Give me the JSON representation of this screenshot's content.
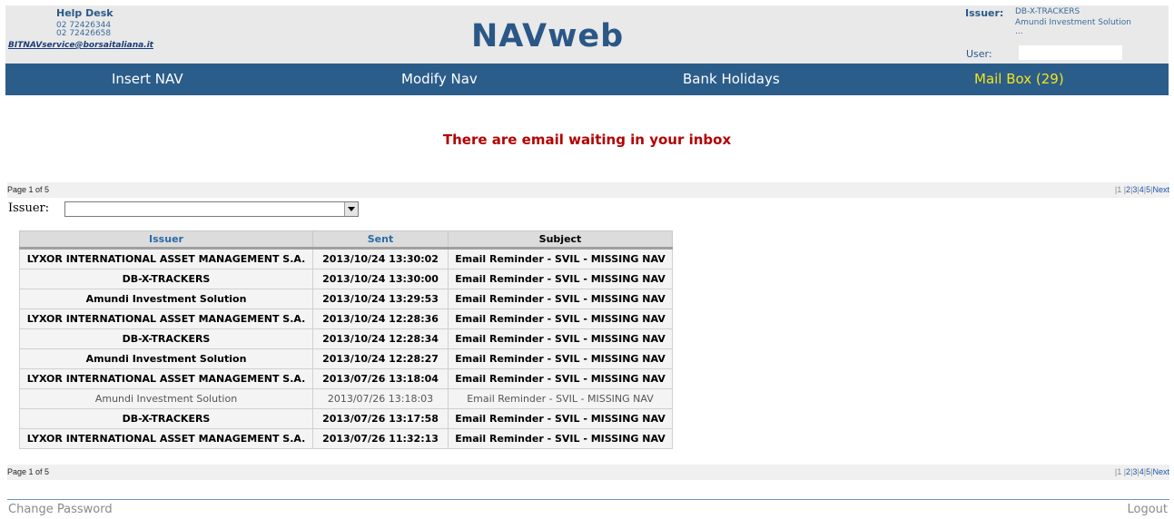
{
  "helpdesk": {
    "title": "Help Desk",
    "phone1": "02 72426344",
    "phone2": "02 72426658",
    "email": "BITNAVservice@borsaitaliana.it"
  },
  "app_title": "NAVweb",
  "issuer_info": {
    "label": "Issuer:",
    "line1": "DB-X-TRACKERS",
    "line2": "Amundi Investment Solution",
    "line3": "..."
  },
  "user": {
    "label": "User:",
    "value": ""
  },
  "nav": {
    "insert": "Insert NAV",
    "modify": "Modify Nav",
    "holidays": "Bank Holidays",
    "mailbox": "Mail Box (29)"
  },
  "alert": "There are email waiting in your inbox",
  "pager": {
    "status": "Page 1 of 5",
    "current": "1",
    "pages": [
      "2",
      "3",
      "4",
      "5"
    ],
    "next": "Next"
  },
  "filter": {
    "label": "Issuer:",
    "value": ""
  },
  "table": {
    "headers": {
      "issuer": "Issuer",
      "sent": "Sent",
      "subject": "Subject"
    },
    "rows": [
      {
        "issuer": "LYXOR INTERNATIONAL ASSET MANAGEMENT S.A.",
        "sent": "2013/10/24 13:30:02",
        "subject": "Email Reminder - SVIL - MISSING NAV"
      },
      {
        "issuer": "DB-X-TRACKERS",
        "sent": "2013/10/24 13:30:00",
        "subject": "Email Reminder - SVIL - MISSING NAV"
      },
      {
        "issuer": "Amundi Investment Solution",
        "sent": "2013/10/24 13:29:53",
        "subject": "Email Reminder - SVIL - MISSING NAV"
      },
      {
        "issuer": "LYXOR INTERNATIONAL ASSET MANAGEMENT S.A.",
        "sent": "2013/10/24 12:28:36",
        "subject": "Email Reminder - SVIL - MISSING NAV"
      },
      {
        "issuer": "DB-X-TRACKERS",
        "sent": "2013/10/24 12:28:34",
        "subject": "Email Reminder - SVIL - MISSING NAV"
      },
      {
        "issuer": "Amundi Investment Solution",
        "sent": "2013/10/24 12:28:27",
        "subject": "Email Reminder - SVIL - MISSING NAV"
      },
      {
        "issuer": "LYXOR INTERNATIONAL ASSET MANAGEMENT S.A.",
        "sent": "2013/07/26 13:18:04",
        "subject": "Email Reminder - SVIL - MISSING NAV"
      },
      {
        "issuer": "Amundi Investment Solution",
        "sent": "2013/07/26 13:18:03",
        "subject": "Email Reminder - SVIL - MISSING NAV"
      },
      {
        "issuer": "DB-X-TRACKERS",
        "sent": "2013/07/26 13:17:58",
        "subject": "Email Reminder - SVIL - MISSING NAV"
      },
      {
        "issuer": "LYXOR INTERNATIONAL ASSET MANAGEMENT S.A.",
        "sent": "2013/07/26 11:32:13",
        "subject": "Email Reminder - SVIL - MISSING NAV"
      }
    ],
    "read_rows": [
      7
    ]
  },
  "footer": {
    "change_password": "Change Password",
    "logout": "Logout"
  },
  "colors": {
    "navbar": "#2b5d8a",
    "mailbox": "#f2e41c",
    "alert": "#b30000",
    "title": "#2b5787"
  }
}
